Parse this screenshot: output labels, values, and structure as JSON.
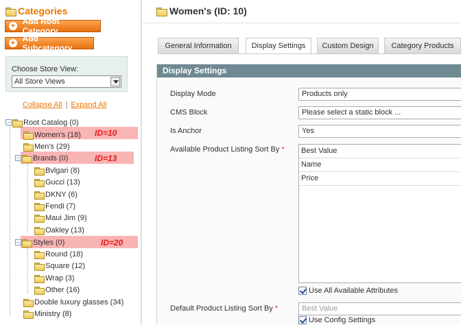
{
  "sidebar": {
    "title": "Categories",
    "add_root_label": "Add Root Category",
    "add_sub_label": "Add Subcategory",
    "store_view_label": "Choose Store View:",
    "store_view_value": "All Store Views",
    "collapse_all": "Collapse All",
    "expand_all": "Expand All",
    "separator": "|",
    "tree": [
      {
        "label": "Root Catalog (0)",
        "level": 0
      },
      {
        "label": "Women's (18)",
        "level": 1,
        "highlight": true,
        "annotation": "ID=10"
      },
      {
        "label": "Men's (29)",
        "level": 1
      },
      {
        "label": "Brands (0)",
        "level": 1,
        "highlight": true,
        "annotation": "ID=13"
      },
      {
        "label": "Bvlgari (8)",
        "level": 2
      },
      {
        "label": "Gucci (13)",
        "level": 2
      },
      {
        "label": "DKNY (6)",
        "level": 2
      },
      {
        "label": "Fendi (7)",
        "level": 2
      },
      {
        "label": "Maui Jim (9)",
        "level": 2
      },
      {
        "label": "Oakley (13)",
        "level": 2
      },
      {
        "label": "Styles (0)",
        "level": 1,
        "highlight": true,
        "annotation": "ID=20"
      },
      {
        "label": "Round (18)",
        "level": 2
      },
      {
        "label": "Square (12)",
        "level": 2
      },
      {
        "label": "Wrap (3)",
        "level": 2
      },
      {
        "label": "Other (16)",
        "level": 2
      },
      {
        "label": "Double luxury glasses (34)",
        "level": 1
      },
      {
        "label": "Ministry (8)",
        "level": 1
      }
    ]
  },
  "main": {
    "page_title": "Women's (ID: 10)",
    "tabs": [
      {
        "label": "General Information",
        "active": false
      },
      {
        "label": "Display Settings",
        "active": true
      },
      {
        "label": "Custom Design",
        "active": false
      },
      {
        "label": "Category Products",
        "active": false
      }
    ],
    "section_title": "Display Settings",
    "fields": {
      "display_mode": {
        "label": "Display Mode",
        "value": "Products only"
      },
      "cms_block": {
        "label": "CMS Block",
        "value": "Please select a static block ..."
      },
      "is_anchor": {
        "label": "Is Anchor",
        "value": "Yes"
      },
      "sort_by": {
        "label": "Available Product Listing Sort By",
        "required": "*",
        "options": [
          "Best Value",
          "Name",
          "Price"
        ],
        "use_all_label": "Use All Available Attributes"
      },
      "default_sort": {
        "label": "Default Product Listing Sort By",
        "required": "*",
        "value": "Best Value",
        "use_config_label": "Use Config Settings"
      }
    }
  },
  "colors": {
    "accent": "#ea7601",
    "section_header": "#6f8992",
    "highlight": "#f9b4b4",
    "annotation": "#e21a1a"
  }
}
